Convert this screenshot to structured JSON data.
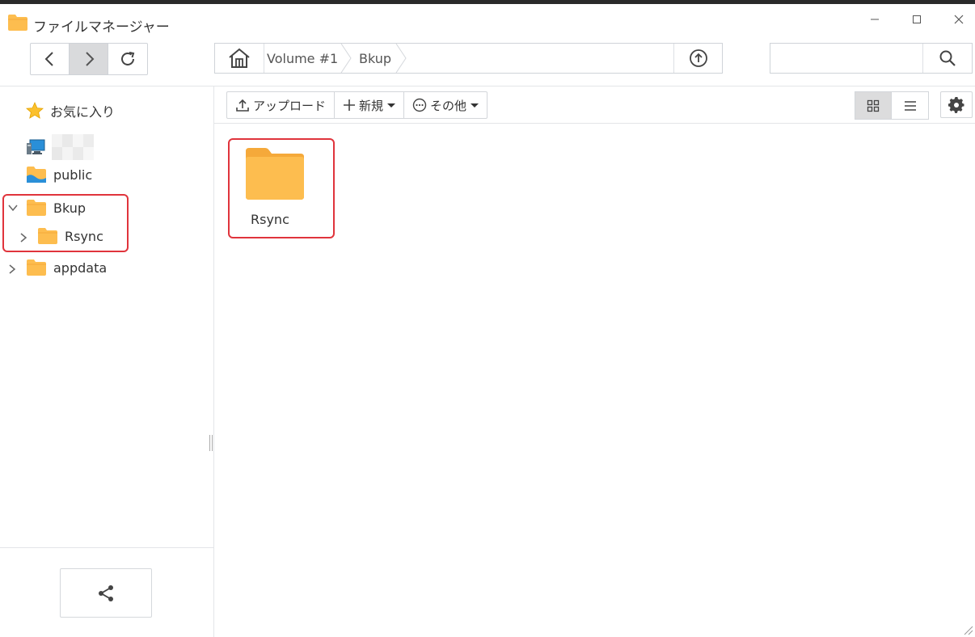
{
  "window": {
    "title": "ファイルマネージャー",
    "controls": {
      "minimize": "–",
      "maximize": "□",
      "close": "✕"
    }
  },
  "nav": {
    "back_icon": "chevron-left-icon",
    "forward_icon": "chevron-right-icon",
    "refresh_icon": "refresh-icon"
  },
  "breadcrumb": {
    "home_icon": "home-icon",
    "items": [
      "Volume #1",
      "Bkup"
    ],
    "up_icon": "upload-circle-icon"
  },
  "search": {
    "value": "",
    "placeholder": ""
  },
  "sidebar": {
    "items": [
      {
        "label": "お気に入り",
        "icon": "star-icon"
      },
      {
        "label": "",
        "icon": "computer-icon",
        "obscured": true
      },
      {
        "label": "public",
        "icon": "shared-folder-icon"
      },
      {
        "label": "Bkup",
        "icon": "folder-icon",
        "expanded": true
      },
      {
        "label": "Rsync",
        "icon": "folder-icon",
        "expanded": false
      },
      {
        "label": "appdata",
        "icon": "folder-icon",
        "expanded": false
      }
    ],
    "share_icon": "share-icon"
  },
  "toolbar": {
    "upload_label": "アップロード",
    "new_label": "新規",
    "more_label": "その他"
  },
  "files": [
    {
      "name": "Rsync",
      "icon": "folder-icon"
    }
  ],
  "colors": {
    "folder": "#fdbd4f",
    "folder_dark": "#f5a93a",
    "highlight": "#e0343c",
    "accent_blue": "#2a8fd8"
  }
}
